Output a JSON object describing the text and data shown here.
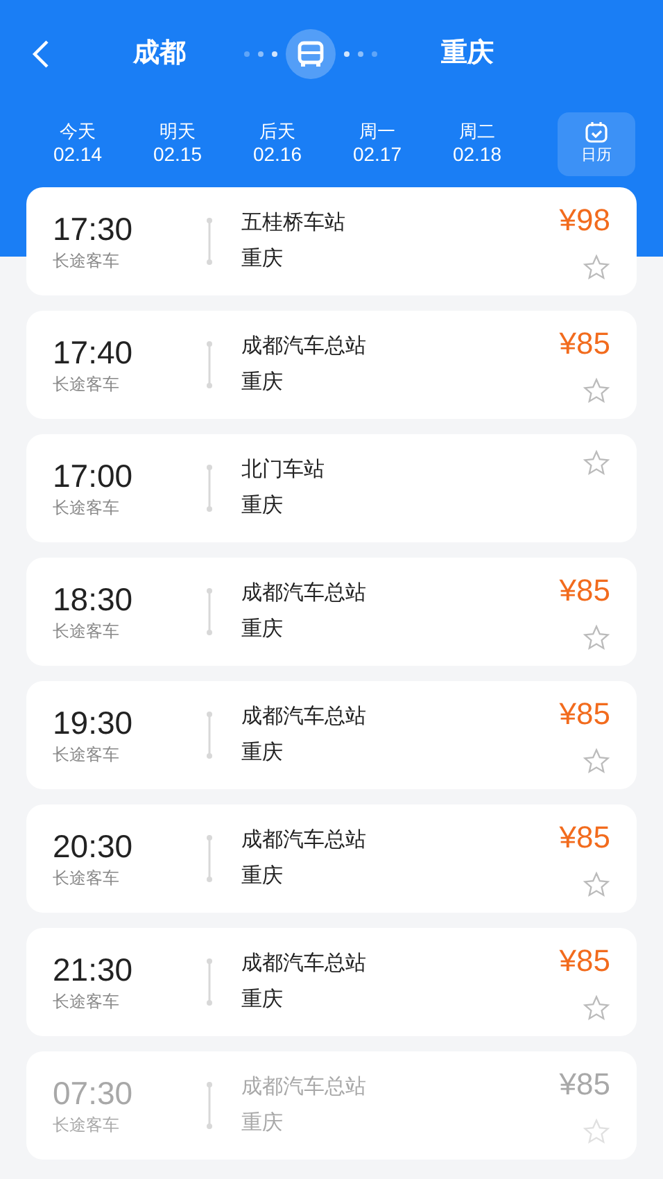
{
  "header": {
    "from": "成都",
    "to": "重庆"
  },
  "dates": [
    {
      "day": "今天",
      "date": "02.14"
    },
    {
      "day": "明天",
      "date": "02.15"
    },
    {
      "day": "后天",
      "date": "02.16"
    },
    {
      "day": "周一",
      "date": "02.17"
    },
    {
      "day": "周二",
      "date": "02.18"
    }
  ],
  "calendar_button": "日历",
  "trips": [
    {
      "time": "17:30",
      "type": "长途客车",
      "from": "五桂桥车站",
      "to": "重庆",
      "price": "¥98",
      "disabled": false
    },
    {
      "time": "17:40",
      "type": "长途客车",
      "from": "成都汽车总站",
      "to": "重庆",
      "price": "¥85",
      "disabled": false
    },
    {
      "time": "17:00",
      "type": "长途客车",
      "from": "北门车站",
      "to": "重庆",
      "disabled": false
    },
    {
      "time": "18:30",
      "type": "长途客车",
      "from": "成都汽车总站",
      "to": "重庆",
      "price": "¥85",
      "disabled": false
    },
    {
      "time": "19:30",
      "type": "长途客车",
      "from": "成都汽车总站",
      "to": "重庆",
      "price": "¥85",
      "disabled": false
    },
    {
      "time": "20:30",
      "type": "长途客车",
      "from": "成都汽车总站",
      "to": "重庆",
      "price": "¥85",
      "disabled": false
    },
    {
      "time": "21:30",
      "type": "长途客车",
      "from": "成都汽车总站",
      "to": "重庆",
      "price": "¥85",
      "disabled": false
    },
    {
      "time": "07:30",
      "type": "长途客车",
      "from": "成都汽车总站",
      "to": "重庆",
      "price": "¥85",
      "disabled": true
    }
  ]
}
